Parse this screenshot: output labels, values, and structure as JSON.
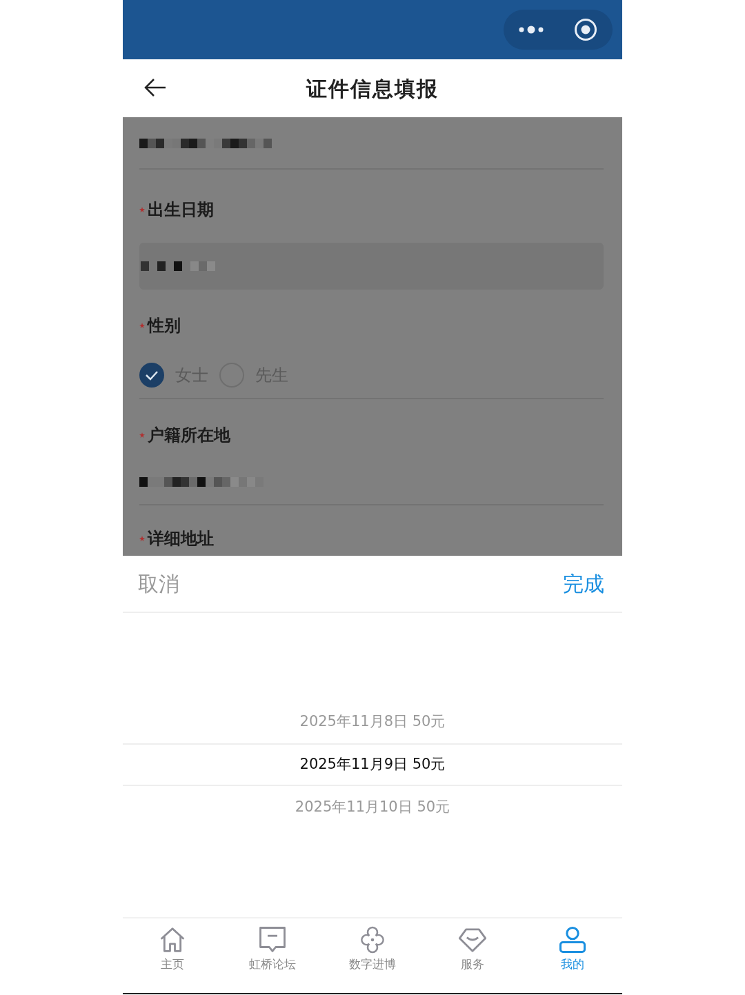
{
  "nav_bar": {
    "title": "证件信息填报"
  },
  "form": {
    "fields": [
      {
        "kind": "value"
      },
      {
        "kind": "date",
        "label": "出生日期",
        "required": true
      },
      {
        "kind": "radio",
        "label": "性别",
        "required": true,
        "options": [
          {
            "label": "女士",
            "selected": true
          },
          {
            "label": "先生",
            "selected": false
          }
        ]
      },
      {
        "kind": "value",
        "label": "户籍所在地",
        "required": true
      },
      {
        "kind": "cut",
        "label": "详细地址",
        "required": true
      }
    ]
  },
  "picker": {
    "cancel": "取消",
    "confirm": "完成",
    "options": [
      {
        "label": "2025年11月8日 50元",
        "selected": false
      },
      {
        "label": "2025年11月9日 50元",
        "selected": true
      },
      {
        "label": "2025年11月10日 50元",
        "selected": false
      }
    ]
  },
  "tab_bar": {
    "tabs": [
      {
        "label": "主页",
        "selected": false
      },
      {
        "label": "虹桥论坛",
        "selected": false
      },
      {
        "label": "数字进博",
        "selected": false
      },
      {
        "label": "服务",
        "selected": false
      },
      {
        "label": "我的",
        "selected": true
      }
    ]
  }
}
